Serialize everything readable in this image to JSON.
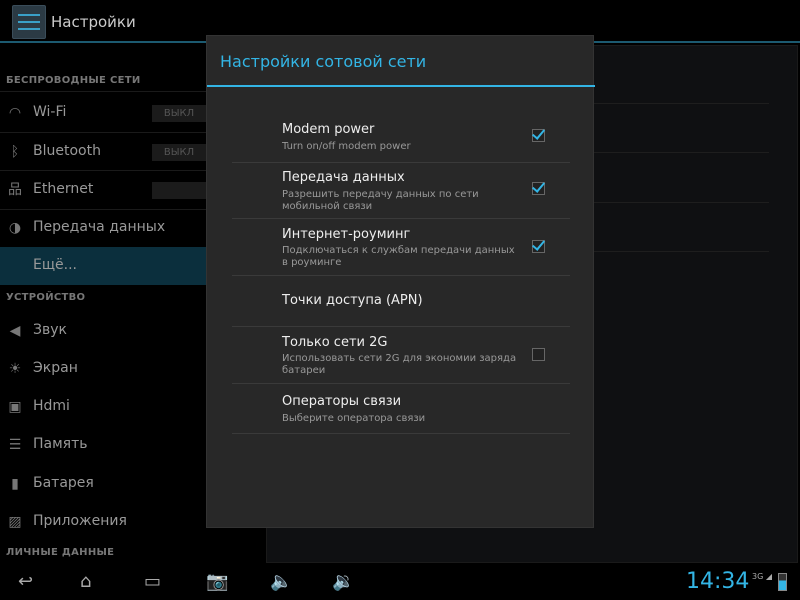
{
  "app": {
    "title": "Настройки"
  },
  "sidebar": {
    "headers": [
      "БЕСПРОВОДНЫЕ СЕТИ",
      "УСТРОЙСТВО",
      "ЛИЧНЫЕ ДАННЫЕ"
    ],
    "items": [
      {
        "label": "Wi-Fi",
        "icon": "wifi-icon",
        "toggle": "ВЫКЛ"
      },
      {
        "label": "Bluetooth",
        "icon": "bluetooth-icon",
        "toggle": "ВЫКЛ"
      },
      {
        "label": "Ethernet",
        "icon": "ethernet-icon"
      },
      {
        "label": "Передача данных",
        "icon": "data-usage-icon"
      },
      {
        "label": "Ещё...",
        "selected": true
      },
      {
        "label": "Звук",
        "icon": "sound-icon"
      },
      {
        "label": "Экран",
        "icon": "display-icon"
      },
      {
        "label": "Hdmi",
        "icon": "hdmi-icon"
      },
      {
        "label": "Память",
        "icon": "storage-icon"
      },
      {
        "label": "Батарея",
        "icon": "battery-icon"
      },
      {
        "label": "Приложения",
        "icon": "apps-icon"
      }
    ]
  },
  "dialog": {
    "title": "Настройки сотовой сети",
    "rows": [
      {
        "title": "Modem power",
        "summary": "Turn on/off modem power",
        "checked": true
      },
      {
        "title": "Передача данных",
        "summary": "Разрешить передачу данных по сети мобильной связи",
        "checked": true
      },
      {
        "title": "Интернет-роуминг",
        "summary": "Подключаться к службам передачи данных в роуминге",
        "checked": true
      },
      {
        "title": "Точки доступа (APN)"
      },
      {
        "title": "Только сети 2G",
        "summary": "Использовать сети 2G для экономии заряда батареи",
        "checked": false
      },
      {
        "title": "Операторы связи",
        "summary": "Выберите оператора связи"
      }
    ]
  },
  "status": {
    "time": "14:34",
    "network": "3G"
  },
  "colors": {
    "accent": "#33b5e5"
  }
}
